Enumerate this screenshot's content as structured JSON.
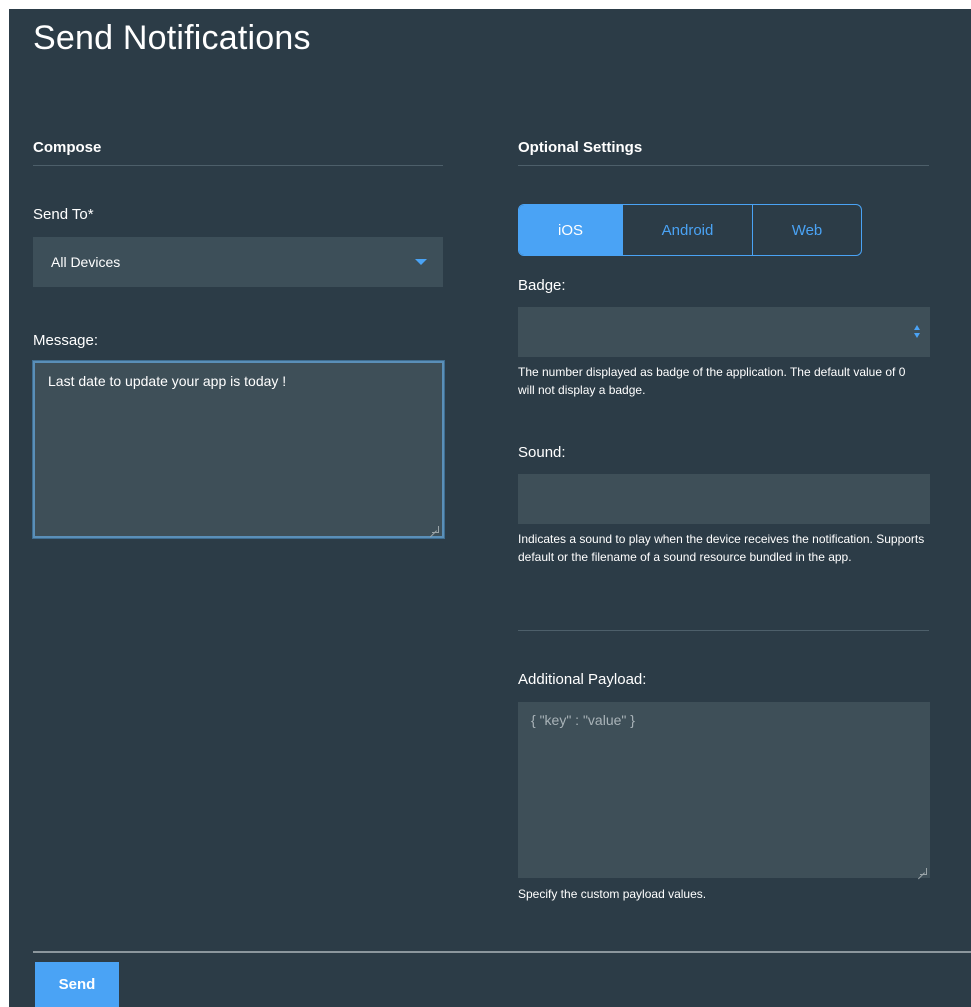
{
  "page": {
    "title": "Send Notifications"
  },
  "compose": {
    "heading": "Compose",
    "send_to_label": "Send To*",
    "send_to_value": "All Devices",
    "message_label": "Message:",
    "message_value": "Last date to update your app is today !"
  },
  "optional": {
    "heading": "Optional Settings",
    "platform_tabs": [
      {
        "label": "iOS",
        "active": true
      },
      {
        "label": "Android",
        "active": false
      },
      {
        "label": "Web",
        "active": false
      }
    ],
    "badge_label": "Badge:",
    "badge_value": "",
    "badge_help": "The number displayed as badge of the application. The default value of 0 will not display a badge.",
    "sound_label": "Sound:",
    "sound_value": "",
    "sound_help": "Indicates a sound to play when the device receives the notification. Supports default or the filename of a sound resource bundled in the app.",
    "payload_label": "Additional Payload:",
    "payload_placeholder": "{ \"key\" : \"value\" }",
    "payload_help": "Specify the custom payload values."
  },
  "footer": {
    "send_label": "Send"
  },
  "colors": {
    "background": "#2c3c47",
    "field": "#3e4f58",
    "accent": "#4aa3f5",
    "text": "#ffffff"
  },
  "icons": {
    "dropdown": "caret-down-icon",
    "stepper": "stepper-arrows-icon"
  }
}
